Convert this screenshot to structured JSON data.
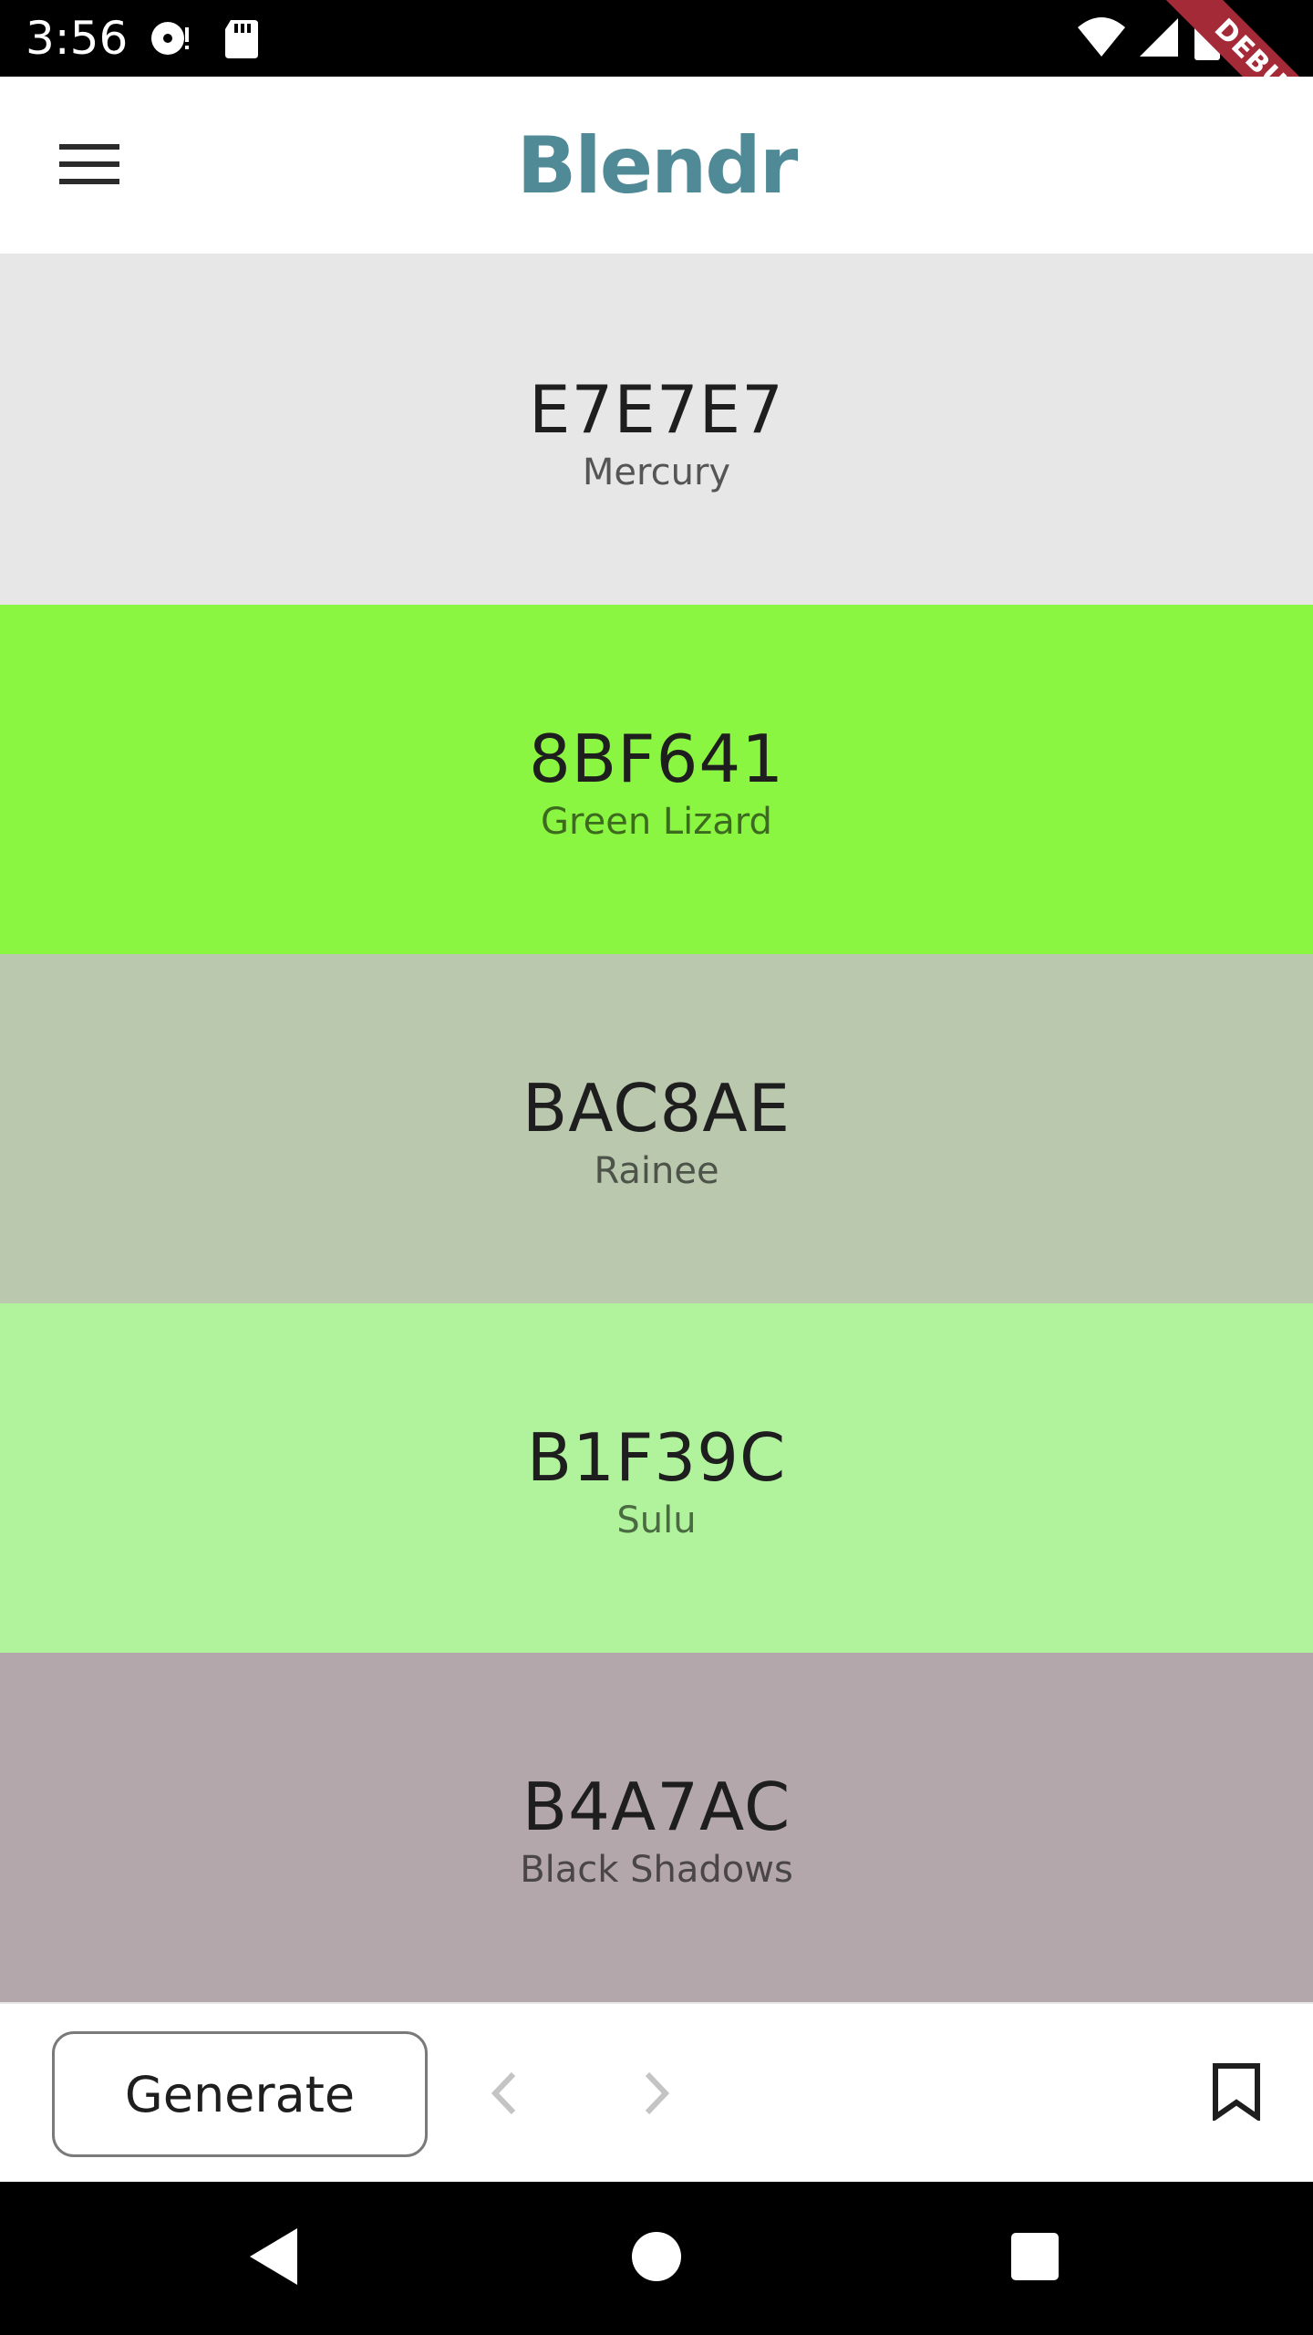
{
  "status_bar": {
    "time": "3:56",
    "icons": [
      "media-icon",
      "sd-card-icon",
      "wifi-icon",
      "signal-icon",
      "battery-icon"
    ]
  },
  "debug_banner": {
    "label": "DEBUG"
  },
  "app_bar": {
    "title": "Blendr",
    "menu_icon": "hamburger-menu-icon"
  },
  "palette": [
    {
      "hex": "E7E7E7",
      "name": "Mercury",
      "background": "#E7E7E7",
      "name_color": "#555555"
    },
    {
      "hex": "8BF641",
      "name": "Green Lizard",
      "background": "#8BF641",
      "name_color": "#3c6a1e"
    },
    {
      "hex": "BAC8AE",
      "name": "Rainee",
      "background": "#BAC8AE",
      "name_color": "#4d5349"
    },
    {
      "hex": "B1F39C",
      "name": "Sulu",
      "background": "#B1F39C",
      "name_color": "#4a6a42"
    },
    {
      "hex": "B4A7AC",
      "name": "Black Shadows",
      "background": "#B4A7AC",
      "name_color": "#4a4547"
    }
  ],
  "toolbar": {
    "generate_label": "Generate",
    "prev_icon": "chevron-left-icon",
    "next_icon": "chevron-right-icon",
    "bookmark_icon": "bookmark-icon"
  },
  "colors": {
    "accent": "#4F8A96",
    "debug_ribbon": "#A52A37"
  }
}
